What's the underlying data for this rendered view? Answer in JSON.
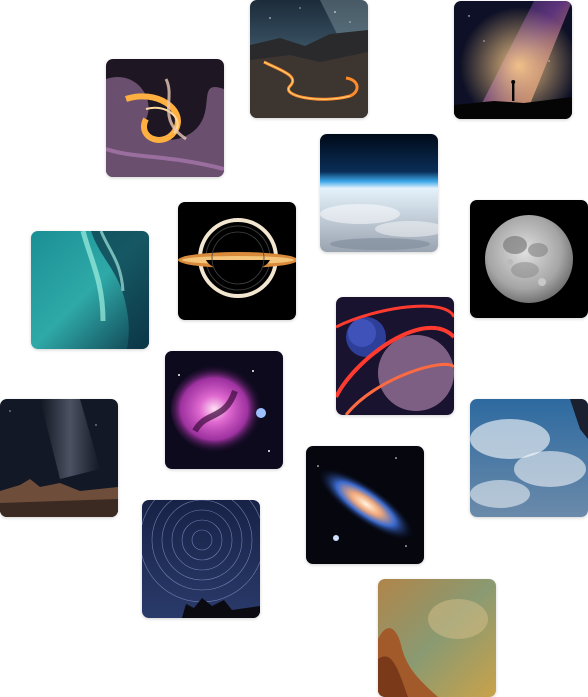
{
  "gallery": {
    "tiles": [
      {
        "name": "mountain-road-milky-way-photo"
      },
      {
        "name": "milky-way-silhouette-photo"
      },
      {
        "name": "fluid-swirl-abstract-photo"
      },
      {
        "name": "earth-horizon-orbit-photo"
      },
      {
        "name": "black-hole-render"
      },
      {
        "name": "full-moon-photo"
      },
      {
        "name": "aurora-borealis-photo"
      },
      {
        "name": "neon-planets-illustration"
      },
      {
        "name": "orion-nebula-photo"
      },
      {
        "name": "earth-from-space-photo"
      },
      {
        "name": "milky-way-badlands-photo"
      },
      {
        "name": "andromeda-galaxy-photo"
      },
      {
        "name": "star-trails-photo"
      },
      {
        "name": "pillars-of-creation-photo"
      }
    ]
  },
  "colors": {
    "background": "#ffffff",
    "space_dark": "#0a0d1a",
    "aurora_teal": "#2fa9a8",
    "neon_red": "#ff3b2f",
    "nebula_magenta": "#c23cc0"
  }
}
